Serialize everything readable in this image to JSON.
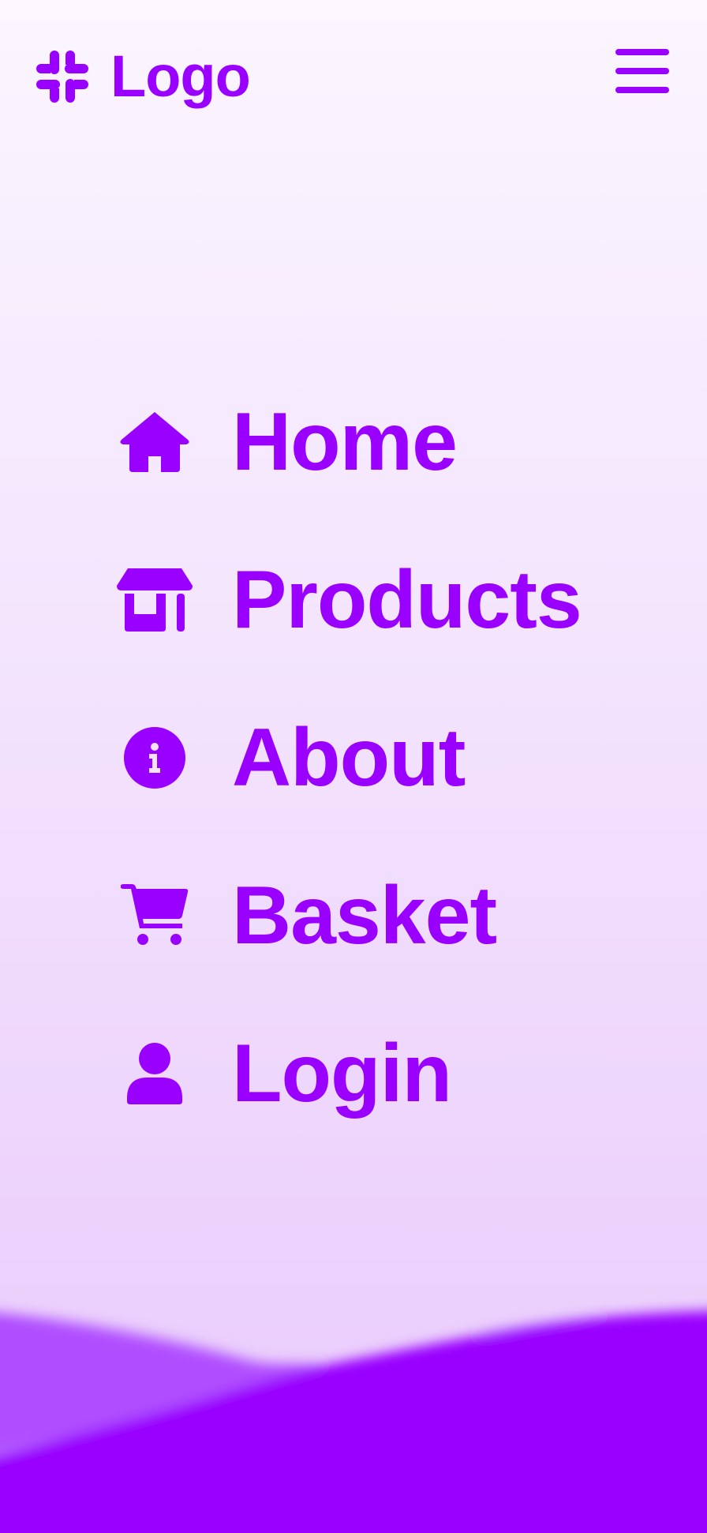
{
  "brand": {
    "logo_text": "Logo",
    "logo_icon": "hash-icon",
    "accent_color": "#9900ff"
  },
  "header": {
    "menu_icon": "hamburger-icon"
  },
  "nav": {
    "items": [
      {
        "label": "Home",
        "icon": "house-icon"
      },
      {
        "label": "Products",
        "icon": "store-icon"
      },
      {
        "label": "About",
        "icon": "info-circle-icon"
      },
      {
        "label": "Basket",
        "icon": "cart-icon"
      },
      {
        "label": "Login",
        "icon": "user-icon"
      }
    ]
  }
}
